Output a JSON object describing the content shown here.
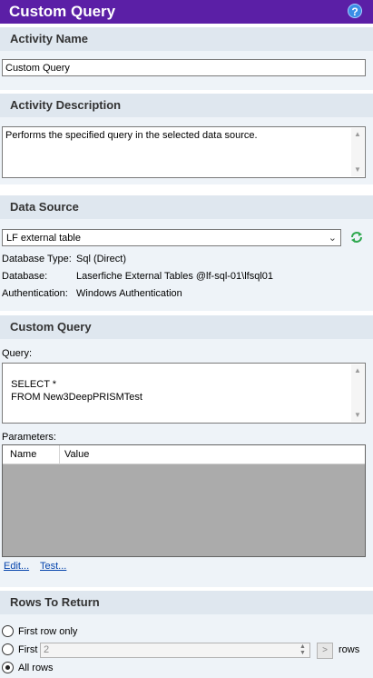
{
  "header": {
    "title": "Custom Query",
    "help_icon": "?"
  },
  "activity_name": {
    "section_title": "Activity Name",
    "value": "Custom Query"
  },
  "activity_description": {
    "section_title": "Activity Description",
    "value": "Performs the specified query in the selected data source."
  },
  "data_source": {
    "section_title": "Data Source",
    "selected": "LF external table",
    "refresh_icon": "refresh-icon",
    "info": [
      {
        "key": "Database Type:",
        "value": "Sql (Direct)"
      },
      {
        "key": "Database:",
        "value": "Laserfiche External Tables @lf-sql-01\\lfsql01"
      },
      {
        "key": "Authentication:",
        "value": "Windows Authentication"
      }
    ]
  },
  "custom_query": {
    "section_title": "Custom Query",
    "query_label": "Query:",
    "query_value": "SELECT *\n  FROM New3DeepPRISMTest",
    "parameters_label": "Parameters:",
    "columns": [
      "Name",
      "Value"
    ],
    "edit_link": "Edit...",
    "test_link": "Test..."
  },
  "rows_to_return": {
    "section_title": "Rows To Return",
    "options": [
      {
        "label": "First row only",
        "checked": false
      },
      {
        "label": "First",
        "checked": false
      },
      {
        "label": "All rows",
        "checked": true
      }
    ],
    "first_count": "2",
    "go_button": ">",
    "rows_label": "rows"
  },
  "colors": {
    "header_bg": "#5b1fa6",
    "section_bg": "#dfe7ef",
    "panel_bg": "#eef3f8",
    "refresh_green": "#2fa84f",
    "link": "#0645ad"
  }
}
